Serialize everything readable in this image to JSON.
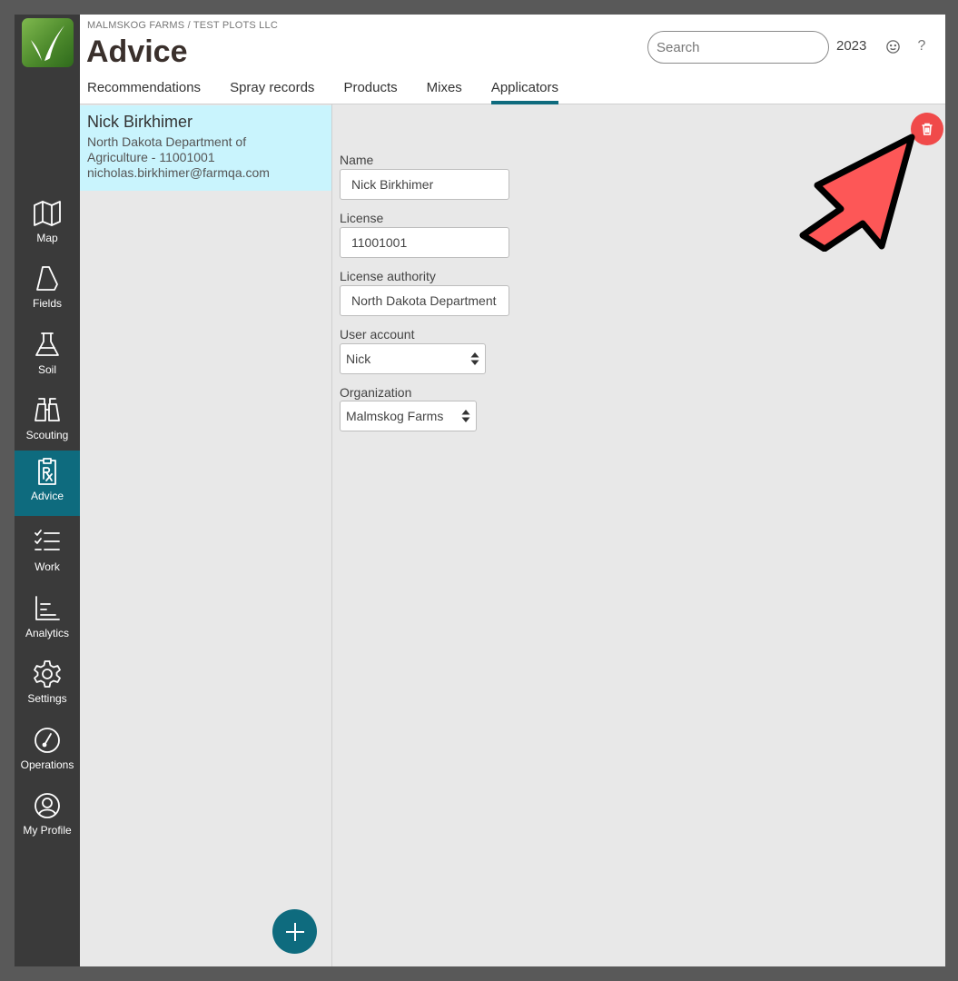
{
  "header": {
    "breadcrumb": "MALMSKOG FARMS / TEST PLOTS LLC",
    "title": "Advice",
    "search_placeholder": "Search",
    "year": "2023",
    "help_glyph": "?"
  },
  "tabs": [
    {
      "label": "Recommendations"
    },
    {
      "label": "Spray records"
    },
    {
      "label": "Products"
    },
    {
      "label": "Mixes"
    },
    {
      "label": "Applicators",
      "active": true
    }
  ],
  "nav": [
    {
      "label": "Map",
      "icon": "map-icon"
    },
    {
      "label": "Fields",
      "icon": "fields-icon"
    },
    {
      "label": "Soil",
      "icon": "flask-icon"
    },
    {
      "label": "Scouting",
      "icon": "binoculars-icon"
    },
    {
      "label": "Advice",
      "icon": "prescription-icon",
      "active": true
    },
    {
      "label": "Work",
      "icon": "checklist-icon"
    },
    {
      "label": "Analytics",
      "icon": "bar-chart-icon"
    },
    {
      "label": "Settings",
      "icon": "gear-icon"
    },
    {
      "label": "Operations",
      "icon": "gauge-icon"
    },
    {
      "label": "My Profile",
      "icon": "user-circle-icon"
    }
  ],
  "applicators": [
    {
      "name": "Nick Birkhimer",
      "line1": "North Dakota Department of",
      "line2": "Agriculture - 11001001",
      "email": "nicholas.birkhimer@farmqa.com"
    }
  ],
  "form": {
    "name_label": "Name",
    "name_value": "Nick Birkhimer",
    "license_label": "License",
    "license_value": "11001001",
    "authority_label": "License authority",
    "authority_value": "North Dakota Department of Agriculture",
    "user_label": "User account",
    "user_value": "Nick",
    "org_label": "Organization",
    "org_value": "Malmskog Farms"
  },
  "colors": {
    "accent": "#0e6b7e",
    "selected_row": "#c9f4fd",
    "delete": "#f04a4a",
    "pointer": "#fd5757"
  }
}
